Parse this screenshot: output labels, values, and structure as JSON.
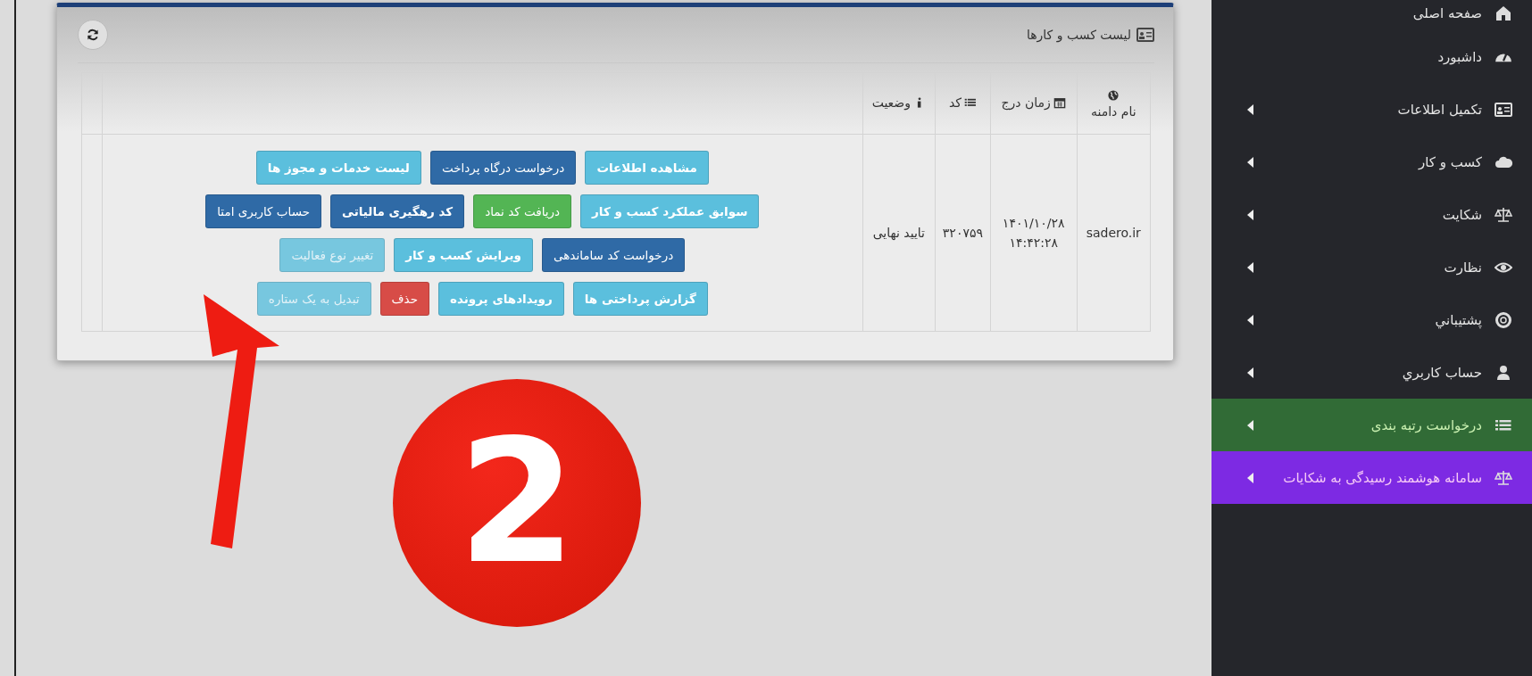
{
  "panel": {
    "title": "لیست کسب و کارها"
  },
  "table": {
    "columns": [
      {
        "label": "نام دامنه"
      },
      {
        "label": "زمان درج"
      },
      {
        "label": "کد"
      },
      {
        "label": "وضعیت"
      }
    ],
    "rows": [
      {
        "domain": "sadero.ir",
        "date": "۱۴۰۱/۱۰/۲۸",
        "time": "۱۴:۴۲:۲۸",
        "code": "۳۲۰۷۵۹",
        "status": "تایید نهایی",
        "actions": [
          [
            {
              "label": "مشاهده اطلاعات",
              "kind": "info",
              "bold": true,
              "disabled": false
            },
            {
              "label": "درخواست درگاه پرداخت",
              "kind": "primary",
              "bold": false,
              "disabled": false
            },
            {
              "label": "لیست خدمات و مجوز ها",
              "kind": "info",
              "bold": true,
              "disabled": false
            }
          ],
          [
            {
              "label": "سوابق عملکرد کسب و کار",
              "kind": "info",
              "bold": true,
              "disabled": false
            },
            {
              "label": "دریافت کد نماد",
              "kind": "success",
              "bold": false,
              "disabled": false
            },
            {
              "label": "کد رهگیری مالیاتی",
              "kind": "primary",
              "bold": true,
              "disabled": false
            },
            {
              "label": "حساب کاربری امتا",
              "kind": "primary",
              "bold": false,
              "disabled": false
            }
          ],
          [
            {
              "label": "درخواست کد ساماندهی",
              "kind": "primary",
              "bold": false,
              "disabled": false
            },
            {
              "label": "ویرایش کسب و کار",
              "kind": "info",
              "bold": true,
              "disabled": false
            },
            {
              "label": "تغییر نوع فعالیت",
              "kind": "info",
              "bold": false,
              "disabled": true
            }
          ],
          [
            {
              "label": "گزارش پرداختی ها",
              "kind": "info",
              "bold": true,
              "disabled": false
            },
            {
              "label": "رویدادهای پرونده",
              "kind": "info",
              "bold": true,
              "disabled": false
            },
            {
              "label": "حذف",
              "kind": "danger",
              "bold": false,
              "disabled": false
            },
            {
              "label": "تبدیل به یک ستاره",
              "kind": "info",
              "bold": false,
              "disabled": true
            }
          ]
        ]
      }
    ]
  },
  "annotation": {
    "step": "2"
  },
  "sidebar": {
    "items": [
      {
        "label": "صفحه اصلی",
        "submenu": false
      },
      {
        "label": "داشبورد",
        "submenu": false
      },
      {
        "label": "تکمیل اطلاعات",
        "submenu": true
      },
      {
        "label": "کسب و کار",
        "submenu": true
      },
      {
        "label": "شکایت",
        "submenu": true
      },
      {
        "label": "نظارت",
        "submenu": true
      },
      {
        "label": "پشتیباني",
        "submenu": true
      },
      {
        "label": "حساب کاربري",
        "submenu": true
      },
      {
        "label": "درخواست رتبه بندی",
        "submenu": true,
        "color": "#316b36"
      },
      {
        "label": "سامانه هوشمند رسیدگی به شکایات",
        "submenu": true,
        "color": "#7d2ae3"
      }
    ]
  }
}
